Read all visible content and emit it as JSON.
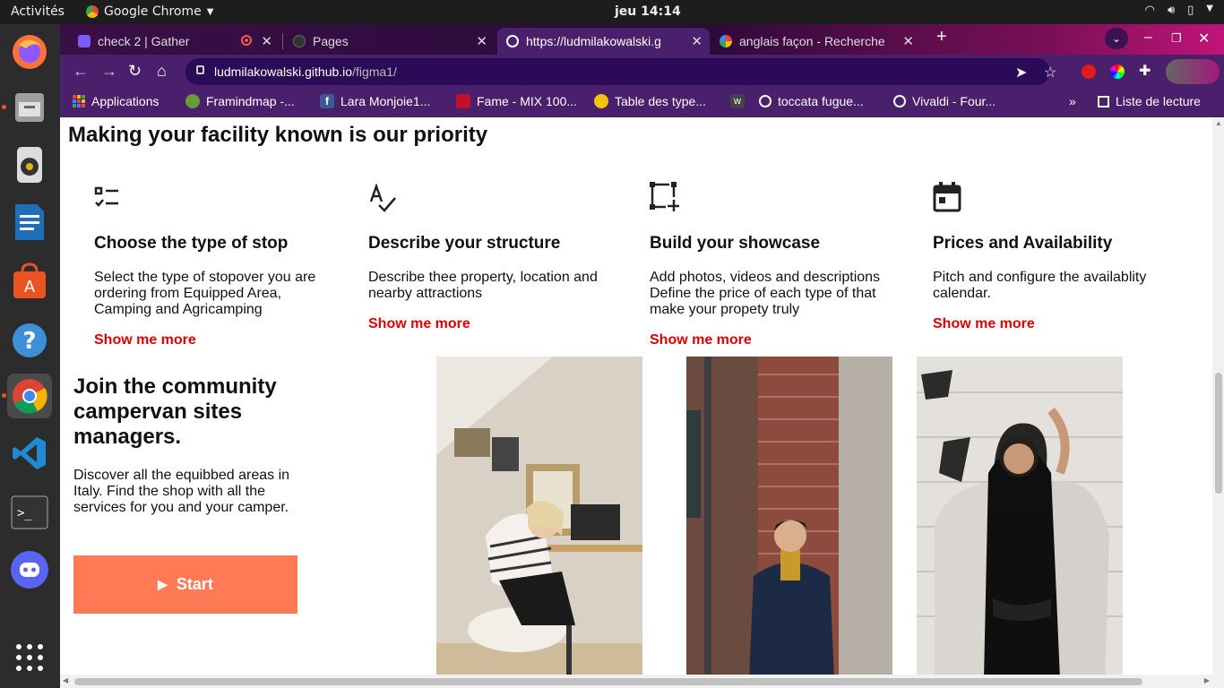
{
  "topbar": {
    "activities": "Activités",
    "app_name": "Google Chrome",
    "clock": "jeu 14:14"
  },
  "dock": {
    "apps": [
      "firefox-icon",
      "files-icon",
      "rhythmbox-icon",
      "writer-icon",
      "software-icon",
      "help-icon",
      "chrome-icon",
      "vscode-icon",
      "terminal-icon",
      "discord-icon",
      "app-grid-icon"
    ]
  },
  "browser": {
    "tabs": [
      {
        "label": "check 2 | Gather"
      },
      {
        "label": "Pages"
      },
      {
        "label": "https://ludmilakowalski.g"
      },
      {
        "label": "anglais façon - Recherche"
      }
    ],
    "url_host": "ludmilakowalski.github.io",
    "url_path": "/figma1/",
    "bookmarks": [
      {
        "label": "Applications",
        "color": "#e8710a"
      },
      {
        "label": "Framindmap -...",
        "color": "#6a9a3a"
      },
      {
        "label": "Lara Monjoie1...",
        "color": "#3b5998"
      },
      {
        "label": "Fame - MIX 100...",
        "color": "#c0102a"
      },
      {
        "label": "Table des type...",
        "color": "#f5c400"
      },
      {
        "label": "",
        "color": "#444444"
      },
      {
        "label": "toccata fugue...",
        "color": "#ffffff"
      },
      {
        "label": "Vivaldi - Four...",
        "color": "#ffffff"
      }
    ],
    "reading_list": "Liste de lecture",
    "more_chevron": "»"
  },
  "page": {
    "title": "Making your facility known is our priority",
    "features": [
      {
        "icon": "checklist-icon",
        "title": "Choose the type of stop",
        "text": "Select the type of stopover you are ordering from Equipped Area, Camping and Agricamping",
        "link": "Show me more"
      },
      {
        "icon": "spellcheck-icon",
        "title": "Describe your structure",
        "text": "Describe thee property, location and nearby attractions",
        "link": "Show me more"
      },
      {
        "icon": "add-frame-icon",
        "title": "Build your showcase",
        "text": "Add photos, videos and descriptions Define the price of each type of that make your propety truly",
        "link": "Show me more"
      },
      {
        "icon": "calendar-icon",
        "title": "Prices and Availability",
        "text": "Pitch and configure the availablity calendar.",
        "link": "Show me more"
      }
    ],
    "join": {
      "title": "Join the community campervan sites managers.",
      "text": "Discover all the equibbed areas in Italy. Find the shop with all the services for you and your camper.",
      "button": "Start"
    },
    "accent_color": "#ff7a55",
    "link_color": "#e00000"
  }
}
